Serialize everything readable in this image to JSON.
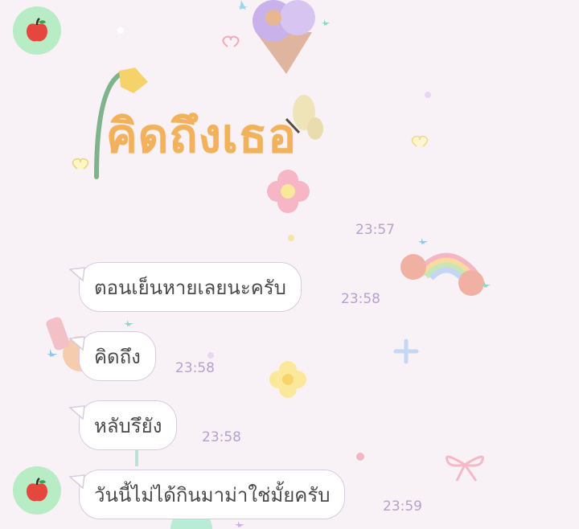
{
  "sticker": {
    "text": "คิดถึงเธอ",
    "time": "23:57"
  },
  "messages": [
    {
      "text": "ตอนเย็นหายเลยนะครับ",
      "time": "23:58"
    },
    {
      "text": "คิดถึง",
      "time": "23:58"
    },
    {
      "text": "หลับรึยัง",
      "time": "23:58"
    },
    {
      "text": "วันนี้ไม่ได้กินมาม่าใช่มั้ยครับ",
      "time": "23:59"
    }
  ],
  "avatar": {
    "icon": "apple-icon",
    "color": "#b8ecc4"
  },
  "colors": {
    "background": "#f8f2f7",
    "bubble_border": "#d8cbe0",
    "time": "#b6a0cc",
    "sticker_text": "#f2b15b"
  }
}
